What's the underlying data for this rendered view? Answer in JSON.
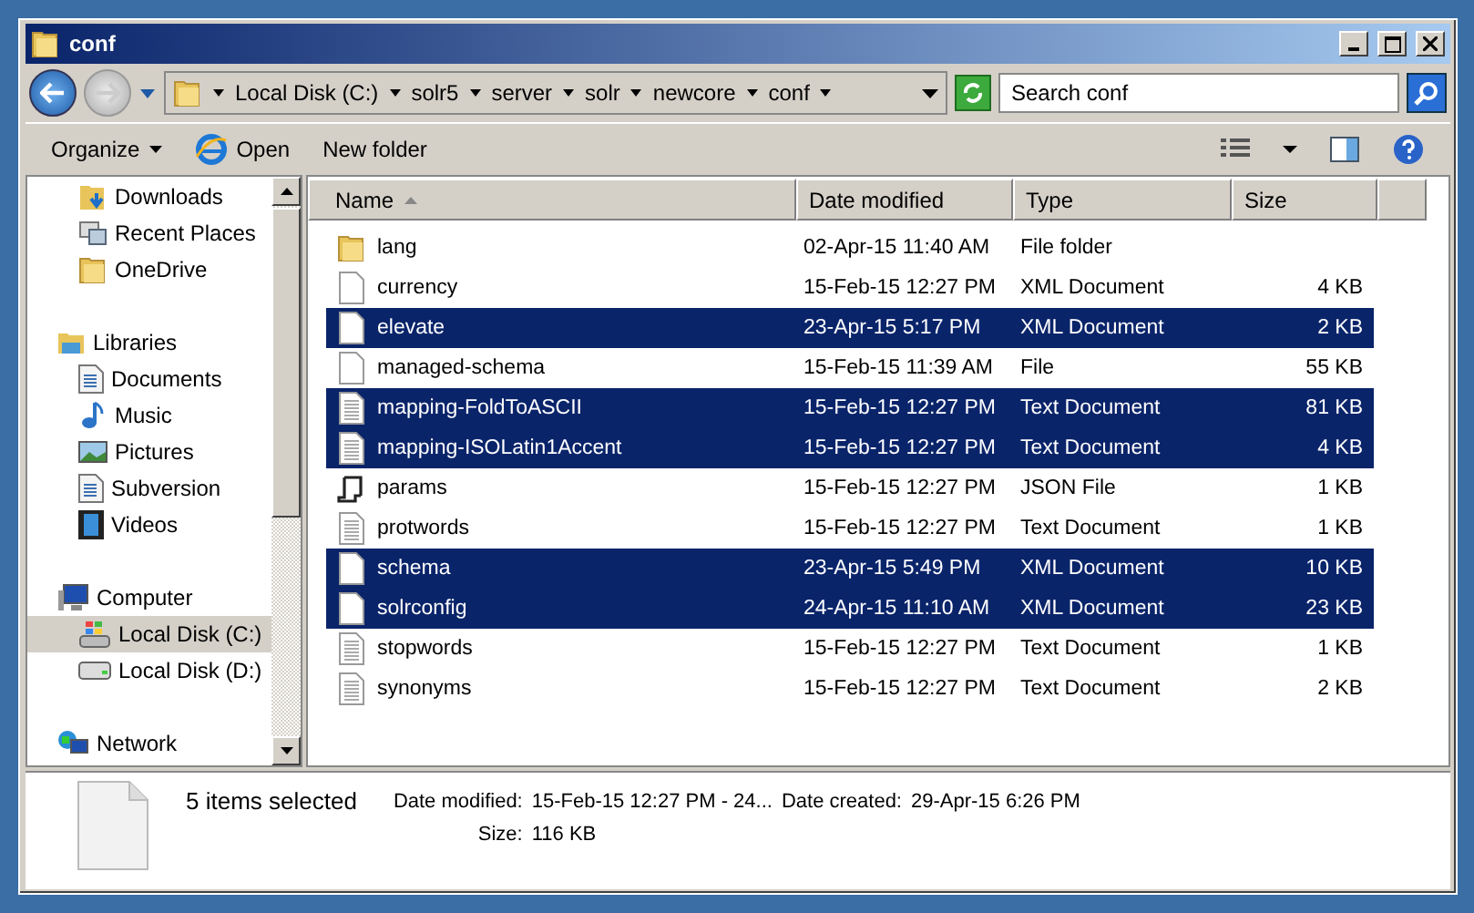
{
  "window": {
    "title": "conf"
  },
  "address": {
    "crumbs": [
      "Local Disk (C:)",
      "solr5",
      "server",
      "solr",
      "newcore",
      "conf"
    ]
  },
  "search": {
    "placeholder": "Search conf"
  },
  "toolbar": [
    {
      "label": "Organize",
      "kind": "menu"
    },
    {
      "label": "Open",
      "kind": "open"
    },
    {
      "label": "New folder",
      "kind": "plain"
    }
  ],
  "sidebar": {
    "items": [
      {
        "label": "Downloads",
        "kind": "downloads",
        "group": false,
        "selected": false
      },
      {
        "label": "Recent Places",
        "kind": "recent",
        "group": false,
        "selected": false
      },
      {
        "label": "OneDrive",
        "kind": "folder",
        "group": false,
        "selected": false
      },
      {
        "label": "Libraries",
        "kind": "libraries",
        "group": true,
        "selected": false
      },
      {
        "label": "Documents",
        "kind": "documents",
        "group": false,
        "selected": false
      },
      {
        "label": "Music",
        "kind": "music",
        "group": false,
        "selected": false
      },
      {
        "label": "Pictures",
        "kind": "pictures",
        "group": false,
        "selected": false
      },
      {
        "label": "Subversion",
        "kind": "documents",
        "group": false,
        "selected": false
      },
      {
        "label": "Videos",
        "kind": "videos",
        "group": false,
        "selected": false
      },
      {
        "label": "Computer",
        "kind": "computer",
        "group": true,
        "selected": false
      },
      {
        "label": "Local Disk (C:)",
        "kind": "windisk",
        "group": false,
        "selected": true
      },
      {
        "label": "Local Disk (D:)",
        "kind": "disk",
        "group": false,
        "selected": false
      },
      {
        "label": "Network",
        "kind": "network",
        "group": true,
        "selected": false
      }
    ]
  },
  "table": {
    "columns": [
      "Name",
      "Date modified",
      "Type",
      "Size"
    ],
    "rows": [
      {
        "name": "lang",
        "date": "02-Apr-15 11:40 AM",
        "type": "File folder",
        "size": "",
        "kind": "folder",
        "selected": false
      },
      {
        "name": "currency",
        "date": "15-Feb-15 12:27 PM",
        "type": "XML Document",
        "size": "4 KB",
        "kind": "blank",
        "selected": false
      },
      {
        "name": "elevate",
        "date": "23-Apr-15 5:17 PM",
        "type": "XML Document",
        "size": "2 KB",
        "kind": "blank",
        "selected": true
      },
      {
        "name": "managed-schema",
        "date": "15-Feb-15 11:39 AM",
        "type": "File",
        "size": "55 KB",
        "kind": "blank",
        "selected": false
      },
      {
        "name": "mapping-FoldToASCII",
        "date": "15-Feb-15 12:27 PM",
        "type": "Text Document",
        "size": "81 KB",
        "kind": "text",
        "selected": true
      },
      {
        "name": "mapping-ISOLatin1Accent",
        "date": "15-Feb-15 12:27 PM",
        "type": "Text Document",
        "size": "4 KB",
        "kind": "text",
        "selected": true
      },
      {
        "name": "params",
        "date": "15-Feb-15 12:27 PM",
        "type": "JSON File",
        "size": "1 KB",
        "kind": "script",
        "selected": false
      },
      {
        "name": "protwords",
        "date": "15-Feb-15 12:27 PM",
        "type": "Text Document",
        "size": "1 KB",
        "kind": "text",
        "selected": false
      },
      {
        "name": "schema",
        "date": "23-Apr-15 5:49 PM",
        "type": "XML Document",
        "size": "10 KB",
        "kind": "blank",
        "selected": true
      },
      {
        "name": "solrconfig",
        "date": "24-Apr-15 11:10 AM",
        "type": "XML Document",
        "size": "23 KB",
        "kind": "blank",
        "selected": true
      },
      {
        "name": "stopwords",
        "date": "15-Feb-15 12:27 PM",
        "type": "Text Document",
        "size": "1 KB",
        "kind": "text",
        "selected": false
      },
      {
        "name": "synonyms",
        "date": "15-Feb-15 12:27 PM",
        "type": "Text Document",
        "size": "2 KB",
        "kind": "text",
        "selected": false
      }
    ]
  },
  "details": {
    "summary": "5 items selected",
    "fields": [
      {
        "label": "Date modified:",
        "value": "15-Feb-15 12:27 PM - 24..."
      },
      {
        "label": "Date created:",
        "value": "29-Apr-15 6:26 PM"
      },
      {
        "label": "Size:",
        "value": "116 KB"
      }
    ]
  }
}
